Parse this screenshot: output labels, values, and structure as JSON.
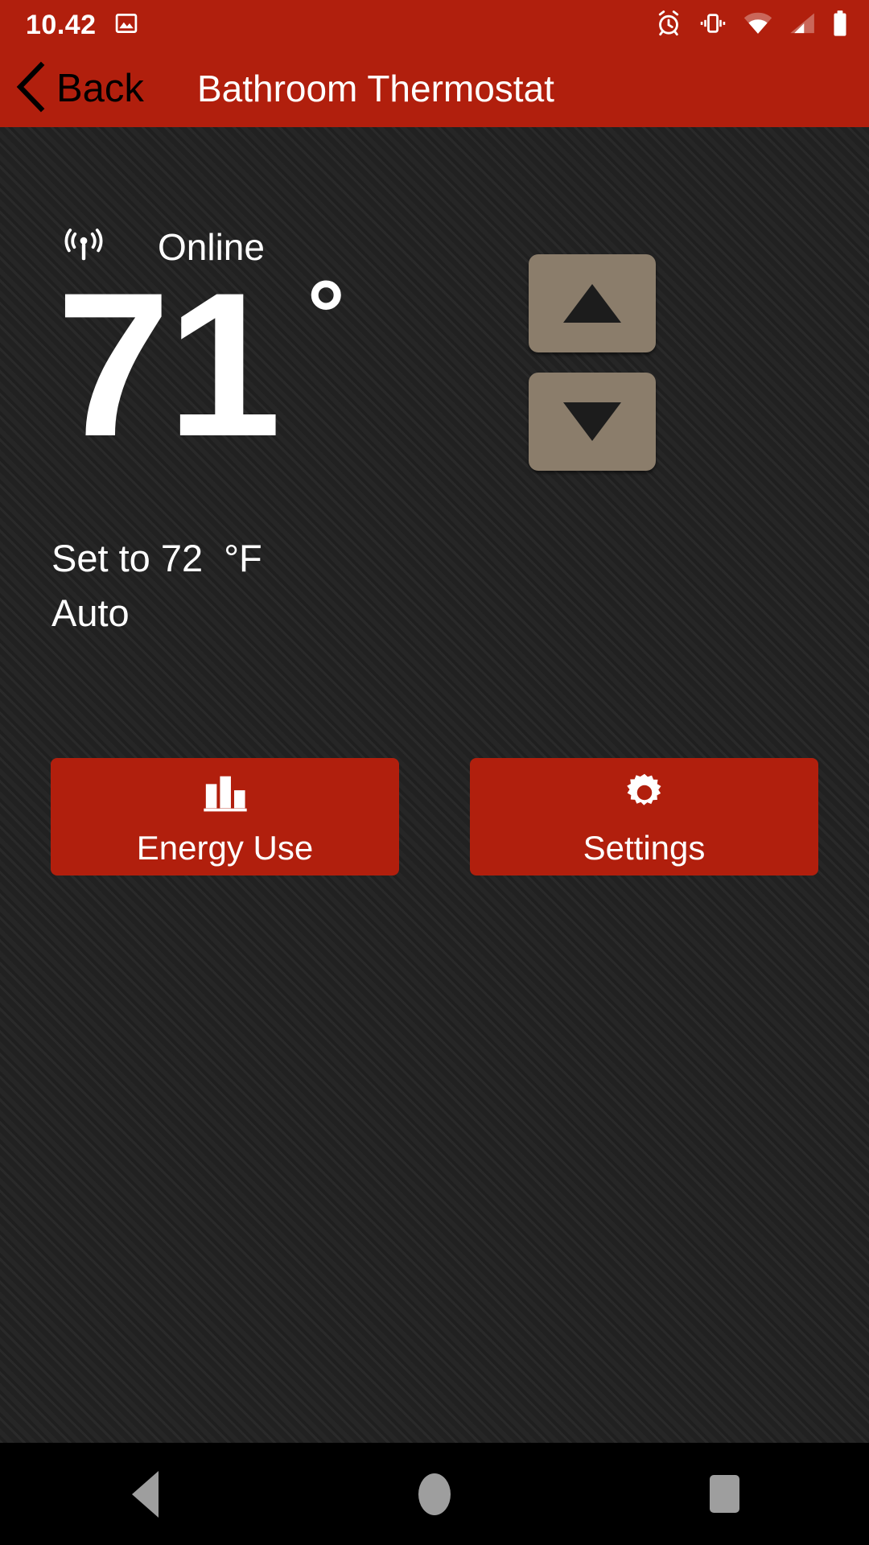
{
  "status_bar": {
    "clock": "10.42",
    "left_icons": [
      {
        "name": "image-icon"
      }
    ],
    "right_icons": [
      {
        "name": "alarm-icon"
      },
      {
        "name": "vibrate-icon"
      },
      {
        "name": "wifi-icon"
      },
      {
        "name": "cell-signal-icon"
      },
      {
        "name": "battery-icon"
      }
    ]
  },
  "app_bar": {
    "back_label": "Back",
    "back_icon": "chevron-left-icon",
    "title": "Bathroom Thermostat",
    "background_color": "#B11F0D",
    "title_color": "#FFFFFF",
    "back_label_color": "#000000"
  },
  "device": {
    "connectivity_icon": "broadcast-icon",
    "connectivity_status": "Online",
    "current_temperature": "71",
    "degree_symbol": "°",
    "setpoint_line": "Set to 72  °F",
    "setpoint_value": "72",
    "unit": "°F",
    "mode": "Auto"
  },
  "stepper": {
    "increase": {
      "icon": "triangle-up-icon",
      "label": ""
    },
    "decrease": {
      "icon": "triangle-down-icon",
      "label": ""
    },
    "button_color": "#8B7D6B",
    "arrow_color": "#1C1C1C"
  },
  "actions": [
    {
      "id": "energy-use",
      "label": "Energy Use",
      "icon": "bar-chart-icon",
      "color": "#B11F0D"
    },
    {
      "id": "settings",
      "label": "Settings",
      "icon": "gear-icon",
      "color": "#B11F0D"
    }
  ],
  "nav_bar": {
    "back_icon": "nav-back-triangle-icon",
    "home_icon": "nav-home-circle-icon",
    "recents_icon": "nav-recents-square-icon",
    "tint": "#9E9E9E",
    "background_color": "#000000"
  },
  "theme": {
    "content_background": "#232323",
    "accent_red": "#B11F0D",
    "text_primary": "#FFFFFF"
  }
}
